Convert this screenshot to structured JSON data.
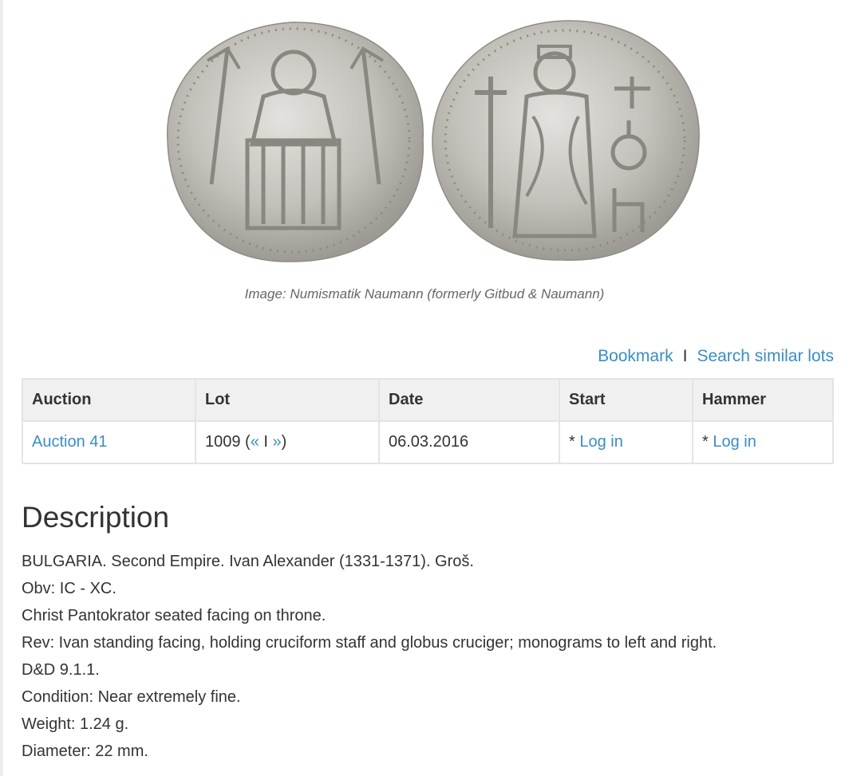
{
  "image": {
    "caption": "Image: Numismatik Naumann (formerly Gitbud & Naumann)",
    "obverse_icon": "coin-obverse-christ-enthroned",
    "reverse_icon": "coin-reverse-tsar-standing"
  },
  "actions": {
    "bookmark": "Bookmark",
    "separator": "I",
    "search_similar": "Search similar lots"
  },
  "table": {
    "headers": [
      "Auction",
      "Lot",
      "Date",
      "Start",
      "Hammer"
    ],
    "row": {
      "auction": "Auction 41",
      "lot_number": "1009",
      "lot_prev": "«",
      "lot_sep": "I",
      "lot_next": "»",
      "date": "06.03.2016",
      "start_prefix": "*",
      "start_link": "Log in",
      "hammer_prefix": "*",
      "hammer_link": "Log in"
    }
  },
  "description": {
    "title": "Description",
    "lines": [
      "BULGARIA. Second Empire. Ivan Alexander (1331-1371). Groš.",
      "Obv: IC - XC.",
      "Christ Pantokrator seated facing on throne.",
      "Rev: Ivan standing facing, holding cruciform staff and globus cruciger; monograms to left and right.",
      "D&D 9.1.1.",
      "Condition: Near extremely fine.",
      "Weight: 1.24 g.",
      "Diameter: 22 mm."
    ]
  },
  "colors": {
    "link": "#3a8dc5",
    "header_bg": "#f0f0f0",
    "border": "#e4e4e4",
    "coin_silver": "#bdbab4"
  }
}
